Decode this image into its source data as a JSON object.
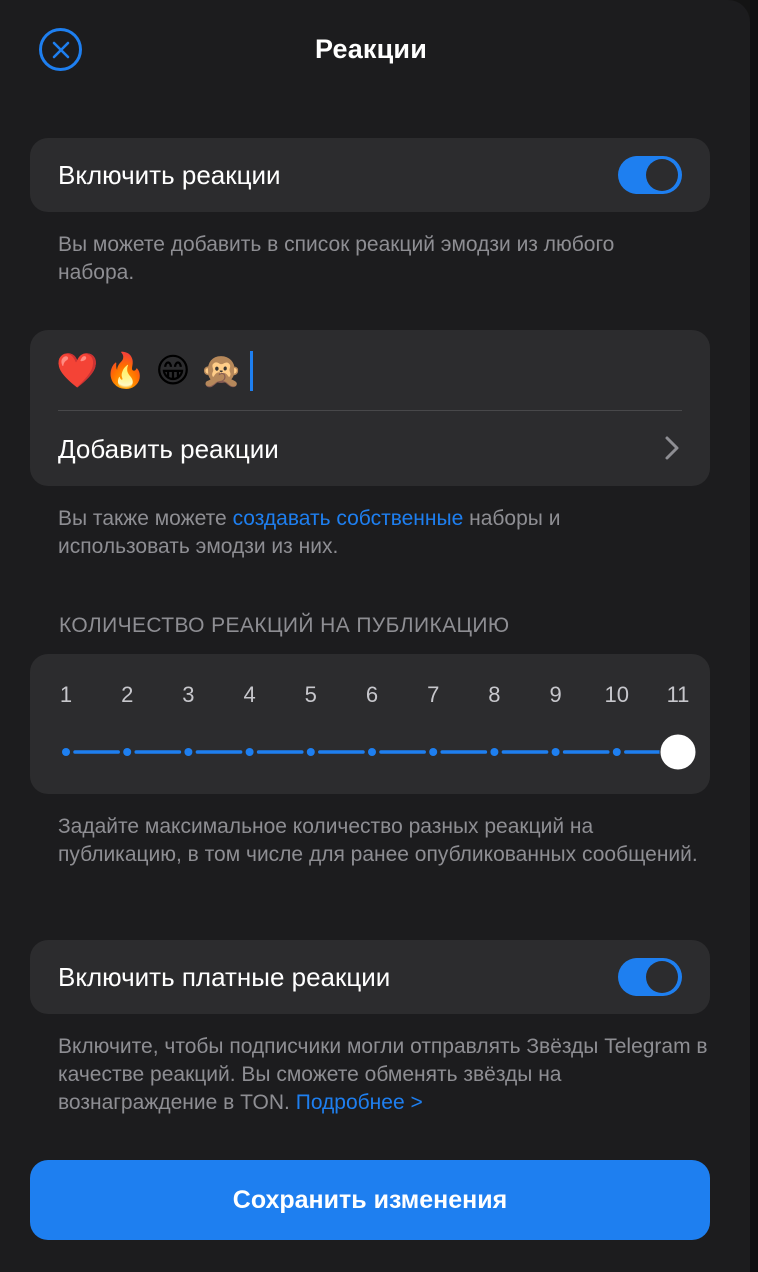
{
  "header": {
    "title": "Реакции",
    "close_icon": "close-circle-icon"
  },
  "enable_reactions": {
    "label": "Включить реакции",
    "enabled": true,
    "hint": "Вы можете добавить в список реакций эмодзи из любого набора."
  },
  "reactions_card": {
    "emojis": [
      "❤️",
      "🔥",
      "😁",
      "🙊"
    ],
    "add_label": "Добавить реакции",
    "chevron_icon": "chevron-right-icon"
  },
  "custom_hint": {
    "before": "Вы также можете ",
    "link": "создавать собственные",
    "after": " наборы и использовать эмодзи из них."
  },
  "count_section": {
    "heading": "КОЛИЧЕСТВО РЕАКЦИЙ НА ПУБЛИКАЦИЮ",
    "ticks": [
      "1",
      "2",
      "3",
      "4",
      "5",
      "6",
      "7",
      "8",
      "9",
      "10",
      "11"
    ],
    "selected": 11,
    "hint": "Задайте максимальное количество разных реакций на публикацию, в том числе для ранее опубликованных сообщений."
  },
  "paid_reactions": {
    "label": "Включить платные реакции",
    "enabled": true,
    "hint_text": "Включите, чтобы подписчики могли отправлять Звёзды Telegram в качестве реакций. Вы сможете обменять звёзды на вознаграждение в TON. ",
    "hint_link": "Подробнее >"
  },
  "save_button": {
    "label": "Сохранить изменения"
  },
  "colors": {
    "accent": "#1e7ff0",
    "background": "#1c1c1e",
    "card": "#2c2c2e",
    "secondary_text": "#8e8e93"
  }
}
